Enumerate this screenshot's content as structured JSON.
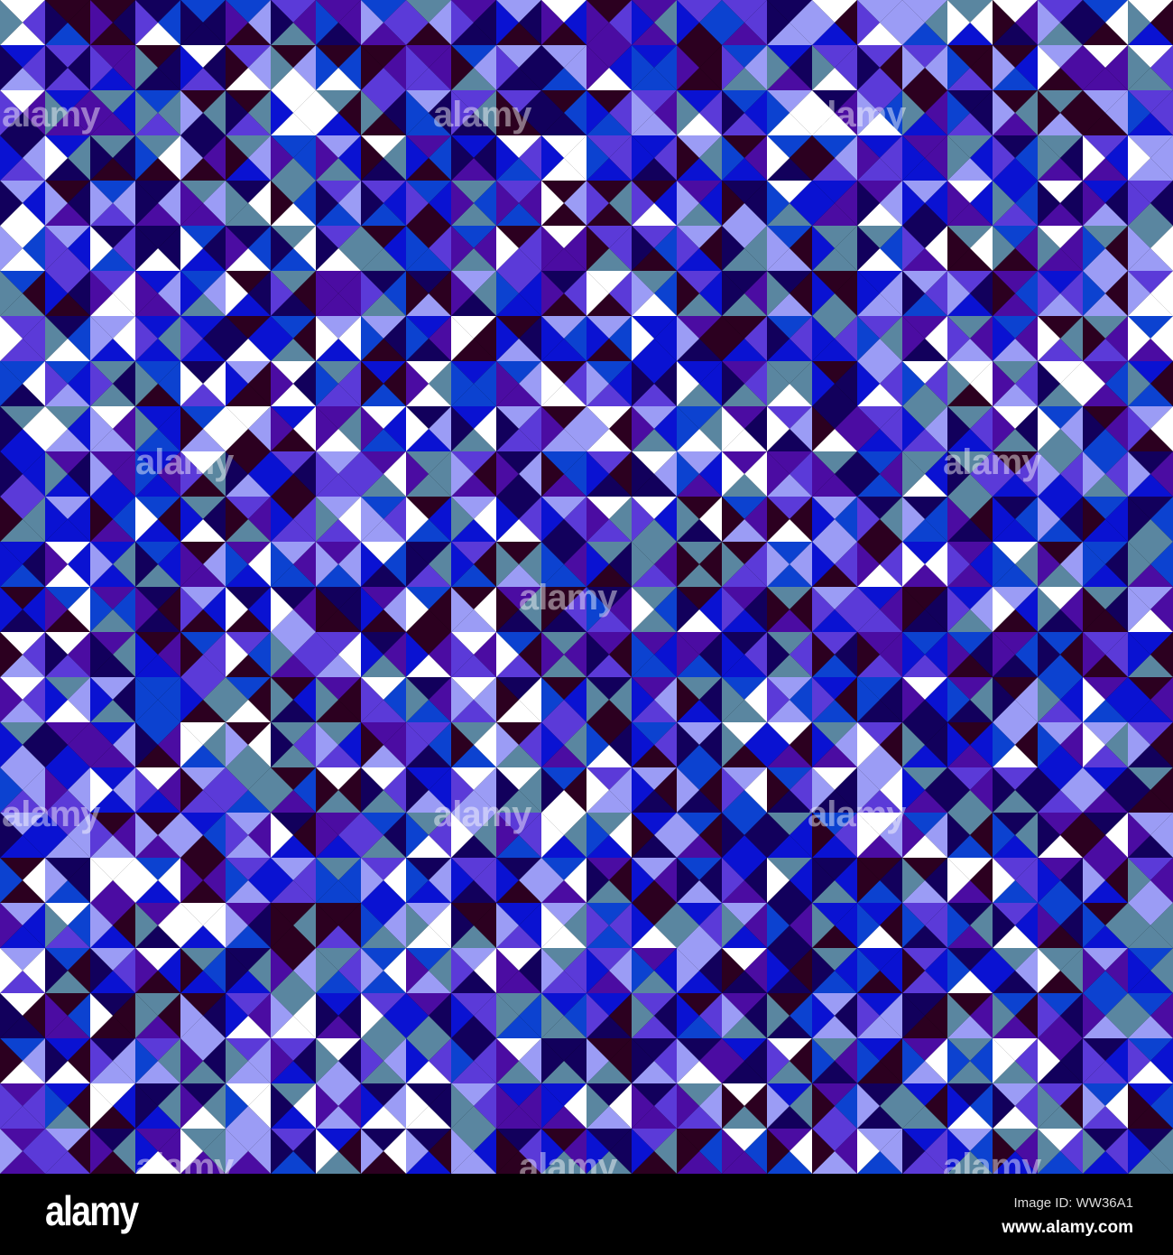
{
  "image": {
    "palette": [
      "#0a12d2",
      "#0c42d0",
      "#5b3ad8",
      "#4b0ca2",
      "#9b9cf5",
      "#ffffff",
      "#2c0020",
      "#12005c",
      "#5a86a0"
    ],
    "watermark_text": "alamy"
  },
  "footer": {
    "logo": "alamy",
    "image_id": "Image ID: WW36A1",
    "url": "www.alamy.com"
  }
}
